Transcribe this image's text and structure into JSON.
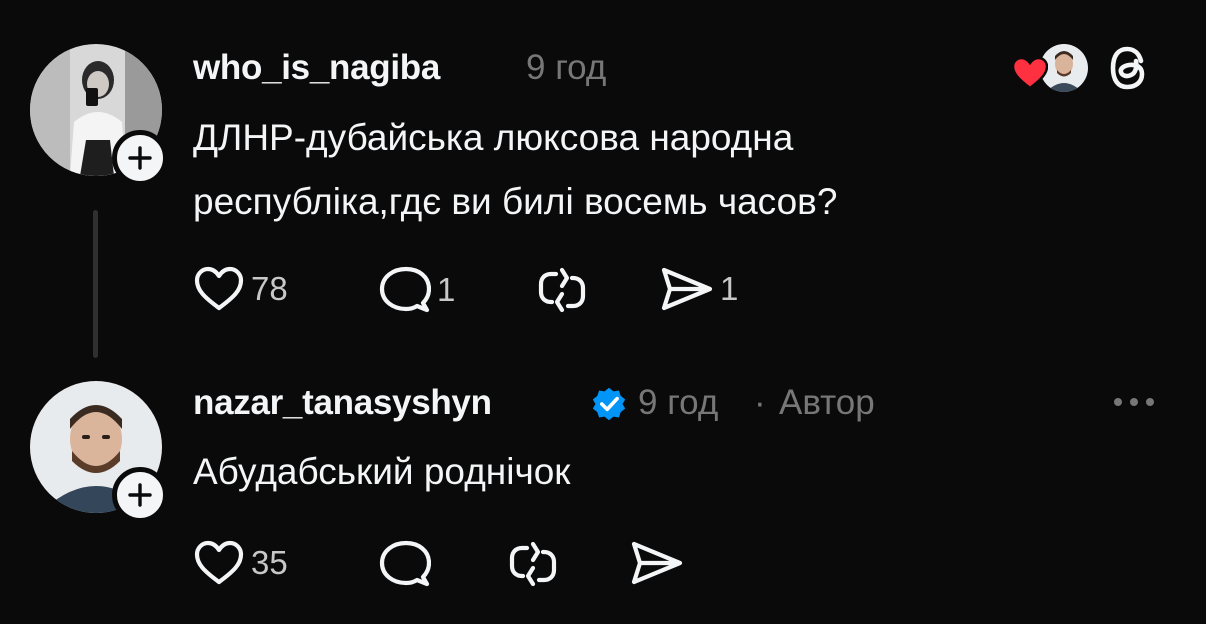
{
  "posts": [
    {
      "username": "who_is_nagiba",
      "time": "9 год",
      "text_lines": [
        "ДЛНР-дубайська люксова народна",
        "республіка,гдє ви билі восемь часов?"
      ],
      "actions": {
        "likes": "78",
        "replies": "1",
        "reposts": "",
        "shares": "1"
      },
      "avatar_icon": "user-avatar-woman",
      "liked_by_icon": "heart-icon"
    },
    {
      "username": "nazar_tanasyshyn",
      "time": "9 год",
      "separator": "·",
      "author_label": "Автор",
      "text_lines": [
        "Абудабський роднічок"
      ],
      "actions": {
        "likes": "35",
        "replies": "",
        "reposts": "",
        "shares": ""
      },
      "avatar_icon": "user-avatar-man",
      "verified_icon": "verified-badge-icon"
    }
  ],
  "colors": {
    "background": "#0a0a0a",
    "text": "#f3f5f7",
    "muted": "#777777",
    "verified": "#0095f6",
    "heart": "#ff3040"
  }
}
